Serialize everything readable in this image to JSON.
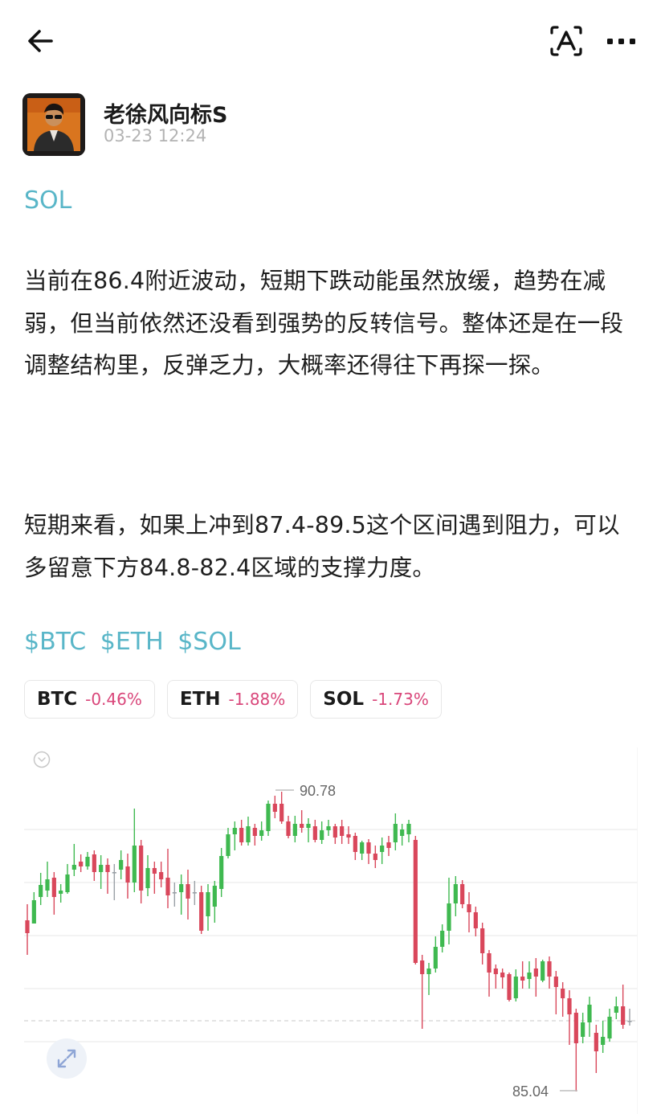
{
  "header": {
    "back_icon": "arrow-left-icon",
    "translate_icon": "translate-icon",
    "more_icon": "more-dots-icon"
  },
  "author": {
    "name": "老徐风向标S",
    "time": "03-23 12:24"
  },
  "post": {
    "tag": "SOL",
    "paragraph1": "当前在86.4附近波动，短期下跌动能虽然放缓，趋势在减弱，但当前依然还没看到强势的反转信号。整体还是在一段调整结构里，反弹乏力，大概率还得往下再探一探。",
    "paragraph2": "短期来看，如果上冲到87.4-89.5这个区间遇到阻力，可以多留意下方84.8-82.4区域的支撑力度。",
    "cashtags": [
      "$BTC",
      "$ETH",
      "$SOL"
    ]
  },
  "tickers": [
    {
      "symbol": "BTC",
      "change": "-0.46%"
    },
    {
      "symbol": "ETH",
      "change": "-1.88%"
    },
    {
      "symbol": "SOL",
      "change": "-1.73%"
    }
  ],
  "chart": {
    "high_label": "90.78",
    "low_label": "85.04",
    "up_color": "#3fb950",
    "down_color": "#d9475b",
    "candles": [
      [
        1161,
        1145,
        1188,
        1125,
        -1
      ],
      [
        1149,
        1120,
        1149,
        1110,
        1
      ],
      [
        1116,
        1101,
        1126,
        1086,
        1
      ],
      [
        1108,
        1094,
        1116,
        1072,
        1
      ],
      [
        1092,
        1116,
        1138,
        1085,
        -1
      ],
      [
        1112,
        1108,
        1123,
        1100,
        1
      ],
      [
        1110,
        1088,
        1112,
        1075,
        1
      ],
      [
        1082,
        1076,
        1090,
        1050,
        1
      ],
      [
        1072,
        1078,
        1085,
        1063,
        -1
      ],
      [
        1078,
        1066,
        1082,
        1060,
        1
      ],
      [
        1063,
        1085,
        1096,
        1058,
        -1
      ],
      [
        1085,
        1076,
        1106,
        1064,
        1
      ],
      [
        1076,
        1085,
        1112,
        1068,
        -1
      ],
      [
        1085,
        1085,
        1120,
        1075,
        0
      ],
      [
        1082,
        1070,
        1094,
        1058,
        1
      ],
      [
        1078,
        1098,
        1118,
        1062,
        -1
      ],
      [
        1098,
        1052,
        1110,
        1006,
        1
      ],
      [
        1052,
        1108,
        1124,
        1045,
        -1
      ],
      [
        1105,
        1080,
        1115,
        1064,
        1
      ],
      [
        1080,
        1087,
        1112,
        1072,
        -1
      ],
      [
        1085,
        1094,
        1104,
        1072,
        -1
      ],
      [
        1092,
        1114,
        1130,
        1056,
        -1
      ],
      [
        1110,
        1110,
        1128,
        1098,
        0
      ],
      [
        1110,
        1100,
        1138,
        1088,
        1
      ],
      [
        1100,
        1118,
        1144,
        1082,
        -1
      ],
      [
        1110,
        1110,
        1126,
        1096,
        0
      ],
      [
        1110,
        1158,
        1162,
        1102,
        -1
      ],
      [
        1140,
        1110,
        1158,
        1100,
        1
      ],
      [
        1128,
        1102,
        1148,
        1096,
        1
      ],
      [
        1106,
        1065,
        1116,
        1055,
        1
      ],
      [
        1065,
        1038,
        1068,
        1030,
        1
      ],
      [
        1038,
        1030,
        1058,
        1022,
        1
      ],
      [
        1030,
        1048,
        1052,
        1020,
        -1
      ],
      [
        1048,
        1028,
        1052,
        1016,
        1
      ],
      [
        1030,
        1040,
        1052,
        1025,
        -1
      ],
      [
        1040,
        1033,
        1046,
        1022,
        1
      ],
      [
        1034,
        1000,
        1040,
        996,
        1
      ],
      [
        1000,
        1010,
        1018,
        990,
        -1
      ],
      [
        1000,
        1022,
        1025,
        985,
        -1
      ],
      [
        1022,
        1040,
        1043,
        1015,
        -1
      ],
      [
        1040,
        1025,
        1048,
        1015,
        1
      ],
      [
        1025,
        1030,
        1036,
        1008,
        -1
      ],
      [
        1030,
        1025,
        1048,
        1018,
        1
      ],
      [
        1028,
        1045,
        1048,
        1020,
        -1
      ],
      [
        1045,
        1033,
        1050,
        1022,
        1
      ],
      [
        1033,
        1028,
        1040,
        1020,
        1
      ],
      [
        1028,
        1042,
        1050,
        1025,
        -1
      ],
      [
        1028,
        1040,
        1050,
        1020,
        -1
      ],
      [
        1038,
        1042,
        1050,
        1028,
        -1
      ],
      [
        1040,
        1060,
        1070,
        1036,
        -1
      ],
      [
        1062,
        1048,
        1070,
        1046,
        1
      ],
      [
        1048,
        1062,
        1075,
        1044,
        -1
      ],
      [
        1062,
        1070,
        1080,
        1052,
        -1
      ],
      [
        1060,
        1052,
        1075,
        1042,
        1
      ],
      [
        1048,
        1055,
        1065,
        1040,
        -1
      ],
      [
        1048,
        1025,
        1058,
        1012,
        1
      ],
      [
        1040,
        1032,
        1052,
        1025,
        1
      ],
      [
        1038,
        1025,
        1048,
        1020,
        1
      ],
      [
        1045,
        1198,
        1200,
        1040,
        -1
      ],
      [
        1195,
        1212,
        1280,
        1188,
        -1
      ],
      [
        1212,
        1205,
        1238,
        1198,
        1
      ],
      [
        1205,
        1178,
        1210,
        1165,
        1
      ],
      [
        1178,
        1158,
        1185,
        1150,
        1
      ],
      [
        1158,
        1124,
        1175,
        1092,
        1
      ],
      [
        1124,
        1100,
        1140,
        1090,
        1
      ],
      [
        1100,
        1125,
        1130,
        1095,
        -1
      ],
      [
        1125,
        1135,
        1160,
        1110,
        -1
      ],
      [
        1135,
        1155,
        1165,
        1128,
        -1
      ],
      [
        1155,
        1186,
        1200,
        1148,
        -1
      ],
      [
        1186,
        1210,
        1240,
        1182,
        -1
      ],
      [
        1205,
        1212,
        1230,
        1200,
        -1
      ],
      [
        1210,
        1216,
        1230,
        1205,
        -1
      ],
      [
        1212,
        1244,
        1246,
        1210,
        -1
      ],
      [
        1242,
        1215,
        1246,
        1206,
        1
      ],
      [
        1215,
        1220,
        1230,
        1196,
        -1
      ],
      [
        1218,
        1210,
        1230,
        1196,
        1
      ],
      [
        1205,
        1215,
        1240,
        1192,
        -1
      ],
      [
        1220,
        1196,
        1222,
        1194,
        1
      ],
      [
        1196,
        1215,
        1230,
        1190,
        -1
      ],
      [
        1215,
        1228,
        1262,
        1208,
        -1
      ],
      [
        1230,
        1242,
        1265,
        1222,
        -1
      ],
      [
        1242,
        1262,
        1300,
        1232,
        -1
      ],
      [
        1260,
        1298,
        1358,
        1255,
        -1
      ],
      [
        1290,
        1272,
        1298,
        1260,
        1
      ],
      [
        1272,
        1250,
        1290,
        1240,
        1
      ],
      [
        1285,
        1308,
        1335,
        1275,
        -1
      ],
      [
        1300,
        1290,
        1310,
        1270,
        1
      ],
      [
        1292,
        1265,
        1296,
        1255,
        1
      ],
      [
        1260,
        1252,
        1268,
        1240,
        1
      ],
      [
        1252,
        1275,
        1280,
        1225,
        -1
      ],
      [
        1270,
        1270,
        1276,
        1255,
        0
      ]
    ]
  }
}
